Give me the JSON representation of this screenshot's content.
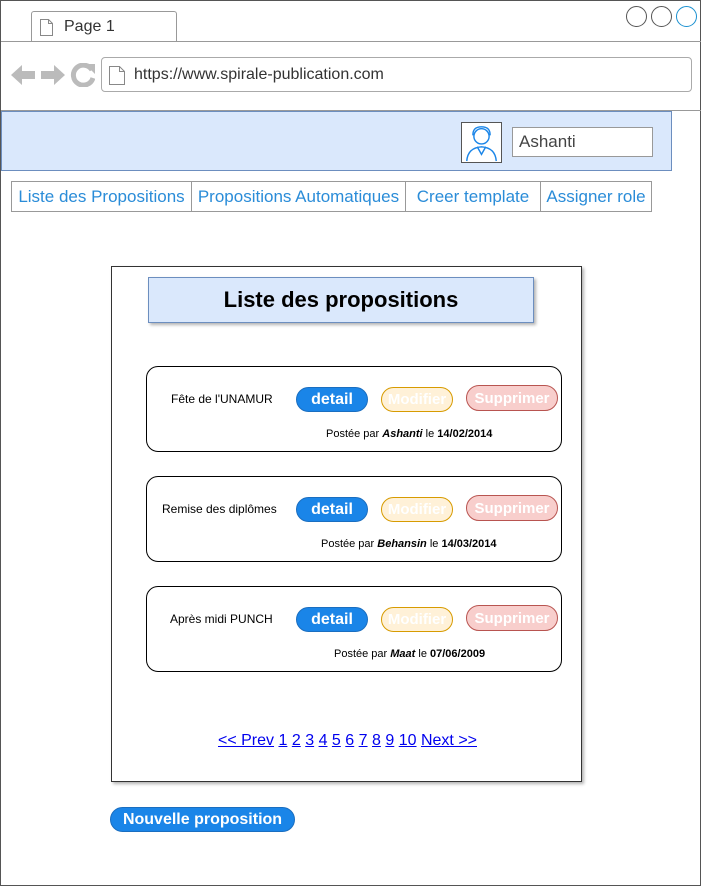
{
  "browser": {
    "tab_label": "Page 1",
    "url": "https://www.spirale-publication.com"
  },
  "header": {
    "username": "Ashanti"
  },
  "nav": {
    "items": [
      {
        "label": "Liste des Propositions"
      },
      {
        "label": "Propositions Automatiques"
      },
      {
        "label": "Creer template"
      },
      {
        "label": "Assigner role"
      }
    ]
  },
  "main": {
    "title": "Liste des propositions",
    "buttons": {
      "detail": "detail",
      "modifier": "Modifier",
      "supprimer": "Supprimer"
    },
    "posted_prefix": "Postée par",
    "posted_on": "le",
    "propositions": [
      {
        "title": "Fête de l'UNAMUR",
        "author": "Ashanti",
        "date": "14/02/2014"
      },
      {
        "title": "Remise des diplômes",
        "author": "Behansin",
        "date": "14/03/2014"
      },
      {
        "title": "Après midi PUNCH",
        "author": "Maat",
        "date": "07/06/2009"
      }
    ],
    "pagination": {
      "prev": "<< Prev",
      "pages": [
        "1",
        "2",
        "3",
        "4",
        "5",
        "6",
        "7",
        "8",
        "9",
        "10"
      ],
      "next": "Next >>"
    },
    "new_button": "Nouvelle proposition"
  },
  "colors": {
    "header_bg": "#dae8fc",
    "link": "#2a8cd8",
    "primary_button": "#1a85e8",
    "modifier_button": "#fff1d8",
    "supprimer_button": "#f8cecc"
  },
  "icons": {
    "back": "arrow-left-icon",
    "forward": "arrow-right-icon",
    "reload": "reload-icon",
    "page": "document-icon",
    "avatar": "user-avatar-icon"
  }
}
